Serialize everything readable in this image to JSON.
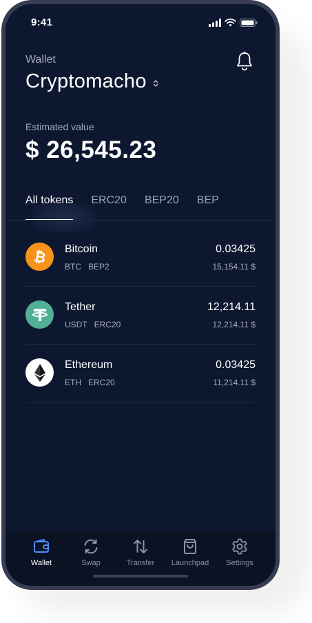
{
  "status_bar": {
    "time": "9:41",
    "icons": [
      "signal-icon",
      "wifi-icon",
      "battery-icon"
    ]
  },
  "header": {
    "wallet_label": "Wallet",
    "wallet_name": "Cryptomacho",
    "wallet_selector_icon": "chevron-updown-icon",
    "notification_icon": "bell-icon"
  },
  "balance": {
    "label": "Estimated value",
    "value": "$ 26,545.23"
  },
  "tabs": [
    {
      "label": "All tokens",
      "active": true
    },
    {
      "label": "ERC20",
      "active": false
    },
    {
      "label": "BEP20",
      "active": false
    },
    {
      "label": "BEP",
      "active": false
    }
  ],
  "tokens": [
    {
      "name": "Bitcoin",
      "symbol": "BTC",
      "network": "BEP2",
      "amount": "0.03425",
      "fiat": "15,154.11 $",
      "icon": "bitcoin-icon",
      "color": "#f7931a"
    },
    {
      "name": "Tether",
      "symbol": "USDT",
      "network": "ERC20",
      "amount": "12,214.11",
      "fiat": "12,214.11 $",
      "icon": "tether-icon",
      "color": "#50af95"
    },
    {
      "name": "Ethereum",
      "symbol": "ETH",
      "network": "ERC20",
      "amount": "0.03425",
      "fiat": "11,214.11 $",
      "icon": "ethereum-icon",
      "color": "#ffffff"
    }
  ],
  "bottom_nav": [
    {
      "label": "Wallet",
      "icon": "wallet-icon",
      "active": true
    },
    {
      "label": "Swap",
      "icon": "swap-icon",
      "active": false
    },
    {
      "label": "Transfer",
      "icon": "transfer-icon",
      "active": false
    },
    {
      "label": "Launchpad",
      "icon": "bag-icon",
      "active": false
    },
    {
      "label": "Settings",
      "icon": "gear-icon",
      "active": false
    }
  ],
  "colors": {
    "background": "#0d1730",
    "frame": "#383c52",
    "accent": "#4c8dff",
    "muted_text": "#a6adbd"
  }
}
